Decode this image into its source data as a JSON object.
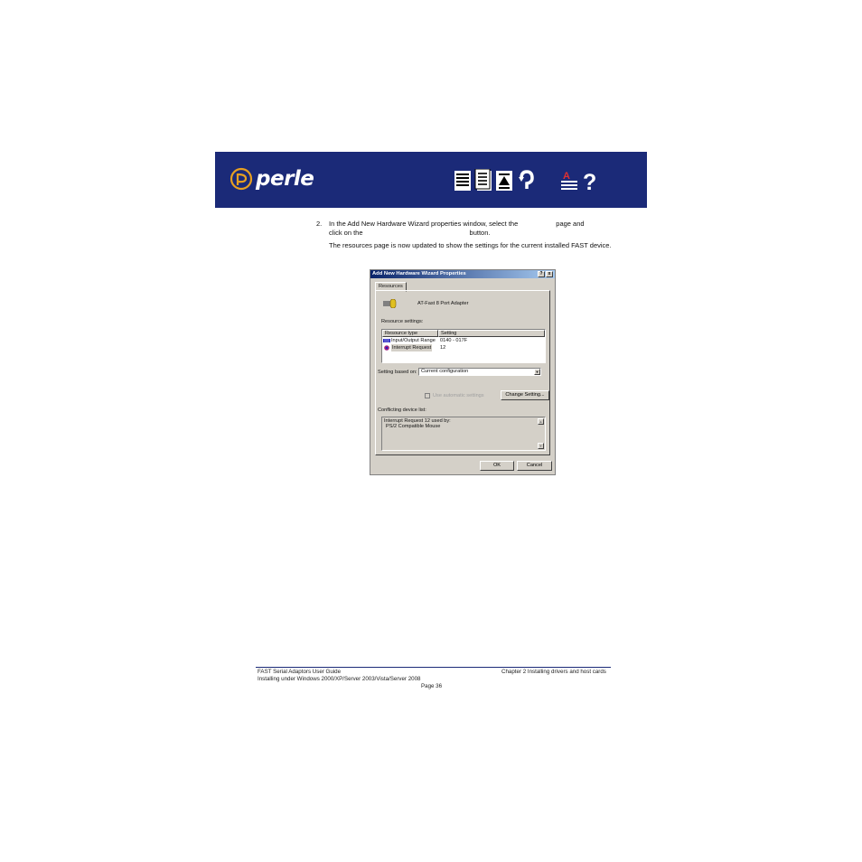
{
  "header": {
    "logo_text": "perle",
    "nav_icons": [
      "contents-icon",
      "index-icon",
      "top-icon",
      "back-icon",
      "glossary-icon",
      "help-icon"
    ],
    "colors": {
      "banner": "#1b2a78"
    }
  },
  "steps": {
    "number": "2.",
    "line1_a": "In the Add New Hardware Wizard properties window, select the",
    "line1_b": "page and",
    "line2_a": "click on the",
    "line2_b": "button.",
    "para": "The resources page is now updated to show the settings for the current installed FAST device."
  },
  "dialog": {
    "title": "Add New Hardware Wizard Properties",
    "help_btn": "?",
    "close_btn": "x",
    "tab": "Resources",
    "device_name": "AT-Fast 8 Port Adapter",
    "resource_label": "Resource settings:",
    "columns": [
      "Resource type",
      "Setting"
    ],
    "rows": [
      {
        "type": "Input/Output Range",
        "setting": "0140 - 017F"
      },
      {
        "type": "Interrupt Request",
        "setting": "12"
      }
    ],
    "setting_label": "Setting based on:",
    "setting_value": "Current configuration",
    "auto_label": "Use automatic settings",
    "change_btn": "Change Setting...",
    "conflict_label": "Conflicting device list:",
    "conflict_line1": "Interrupt Request 12 used by:",
    "conflict_line2": "PS/2 Compatible Mouse",
    "ok": "OK",
    "cancel": "Cancel"
  },
  "footer": {
    "left1": "FAST Serial Adaptors User Guide",
    "left2": "Installing under Windows 2000/XP/Server 2003/Vista/Server 2008",
    "right": "Chapter 2 Installing drivers and host cards",
    "page": "Page 36"
  }
}
